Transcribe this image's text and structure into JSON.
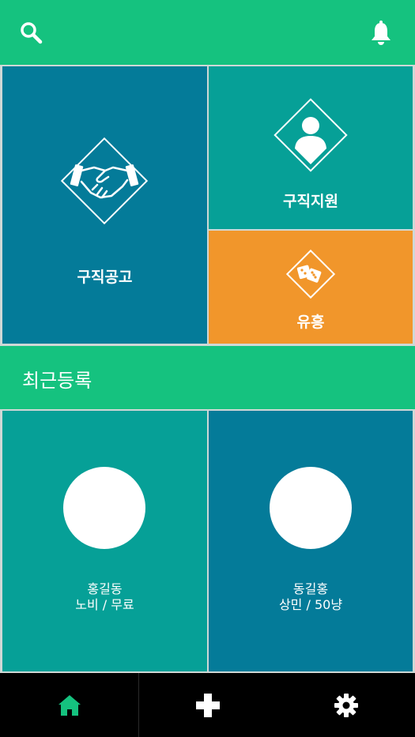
{
  "header": {
    "search_icon": "search-icon",
    "notification_icon": "bell-icon"
  },
  "menu_tiles": [
    {
      "label": "구직공고",
      "icon": "handshake-icon",
      "color": "#047b99"
    },
    {
      "label": "구직지원",
      "icon": "user-icon",
      "color": "#06a097"
    },
    {
      "label": "유흥",
      "icon": "dice-icon",
      "color": "#f1962b"
    }
  ],
  "recent": {
    "title": "최근등록",
    "items": [
      {
        "name": "홍길동",
        "detail": "노비 / 무료",
        "color": "#06a097"
      },
      {
        "name": "동길홍",
        "detail": "상민 / 50냥",
        "color": "#047b99"
      }
    ]
  },
  "bottom_nav": [
    {
      "icon": "home-icon",
      "active": true
    },
    {
      "icon": "plus-icon",
      "active": false
    },
    {
      "icon": "gear-icon",
      "active": false
    }
  ],
  "colors": {
    "accent": "#15c27f",
    "teal_dark": "#047b99",
    "teal": "#06a097",
    "orange": "#f1962b",
    "nav_bg": "#000000"
  }
}
